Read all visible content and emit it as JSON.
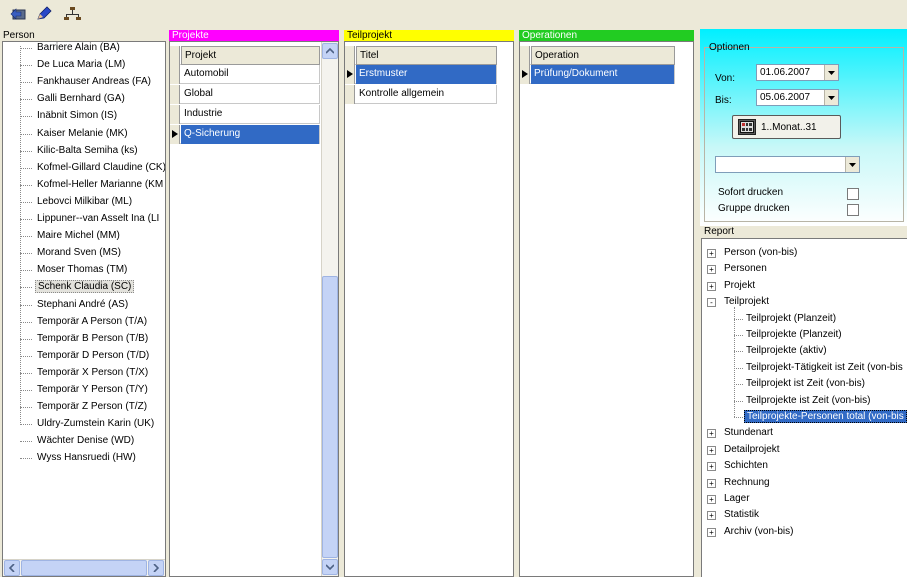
{
  "colors": {
    "projekte_header": "#ff00ff",
    "teilprojekt_header": "#ffff00",
    "operationen_header": "#22cc22",
    "optionen_gradient_from": "#00f0ff",
    "selection": "#316ac5"
  },
  "toolbar": {
    "icons": [
      "back-arrow-icon",
      "edit-pencil-icon",
      "network-tree-icon"
    ]
  },
  "person": {
    "header": "Person",
    "items": [
      "Barriere Alain (BA)",
      "De Luca Maria (LM)",
      "Fankhauser Andreas (FA)",
      "Galli Bernhard (GA)",
      "Inäbnit Simon (IS)",
      "Kaiser Melanie (MK)",
      "Kilic-Balta Semiha (ks)",
      "Kofmel-Gillard Claudine (CK)",
      "Kofmel-Heller Marianne (KM",
      "Lebovci Milkibar (ML)",
      "Lippuner--van Asselt Ina (LI",
      "Maire Michel (MM)",
      "Morand Sven (MS)",
      "Moser Thomas (TM)",
      "Schenk Claudia (SC)",
      "Stephani André (AS)",
      "Temporär A Person (T/A)",
      "Temporär B Person (T/B)",
      "Temporär D Person (T/D)",
      "Temporär X Person (T/X)",
      "Temporär Y Person (T/Y)",
      "Temporär Z Person (T/Z)",
      "Uldry-Zumstein Karin (UK)",
      "Wächter Denise (WD)",
      "Wyss Hansruedi (HW)"
    ],
    "selected_index": 14
  },
  "projekte": {
    "header": "Projekte",
    "column": "Projekt",
    "rows": [
      "Automobil",
      "Global",
      "Industrie",
      "Q-Sicherung"
    ],
    "selected_index": 3
  },
  "teilprojekt": {
    "header": "Teilprojekt",
    "column": "Titel",
    "rows": [
      "Erstmuster",
      "Kontrolle allgemein"
    ],
    "selected_index": 0
  },
  "operationen": {
    "header": "Operationen",
    "column": "Operation",
    "rows": [
      "Prüfung/Dokument"
    ],
    "selected_index": 0
  },
  "optionen": {
    "legend": "Optionen",
    "von_label": "Von:",
    "von_value": "01.06.2007",
    "bis_label": "Bis:",
    "bis_value": "05.06.2007",
    "range_button": "1..Monat..31",
    "dropdown_value": "",
    "sofort_label": "Sofort drucken",
    "gruppe_label": "Gruppe drucken"
  },
  "report": {
    "header": "Report",
    "items": [
      {
        "label": "Person (von-bis)",
        "level": 0,
        "expander": "+"
      },
      {
        "label": "Personen",
        "level": 0,
        "expander": "+"
      },
      {
        "label": "Projekt",
        "level": 0,
        "expander": "+"
      },
      {
        "label": "Teilprojekt",
        "level": 0,
        "expander": "-"
      },
      {
        "label": "Teilprojekt (Planzeit)",
        "level": 1,
        "expander": ""
      },
      {
        "label": "Teilprojekte (Planzeit)",
        "level": 1,
        "expander": ""
      },
      {
        "label": "Teilprojekte (aktiv)",
        "level": 1,
        "expander": ""
      },
      {
        "label": "Teilprojekt-Tätigkeit ist Zeit (von-bis",
        "level": 1,
        "expander": ""
      },
      {
        "label": "Teilprojekt ist Zeit (von-bis)",
        "level": 1,
        "expander": ""
      },
      {
        "label": "Teilprojekte ist Zeit (von-bis)",
        "level": 1,
        "expander": ""
      },
      {
        "label": "Teilprojekte-Personen total (von-bis",
        "level": 1,
        "expander": "",
        "selected": true
      },
      {
        "label": "Stundenart",
        "level": 0,
        "expander": "+"
      },
      {
        "label": "Detailprojekt",
        "level": 0,
        "expander": "+"
      },
      {
        "label": "Schichten",
        "level": 0,
        "expander": "+"
      },
      {
        "label": "Rechnung",
        "level": 0,
        "expander": "+"
      },
      {
        "label": "Lager",
        "level": 0,
        "expander": "+"
      },
      {
        "label": "Statistik",
        "level": 0,
        "expander": "+"
      },
      {
        "label": "Archiv (von-bis)",
        "level": 0,
        "expander": "+"
      }
    ]
  }
}
